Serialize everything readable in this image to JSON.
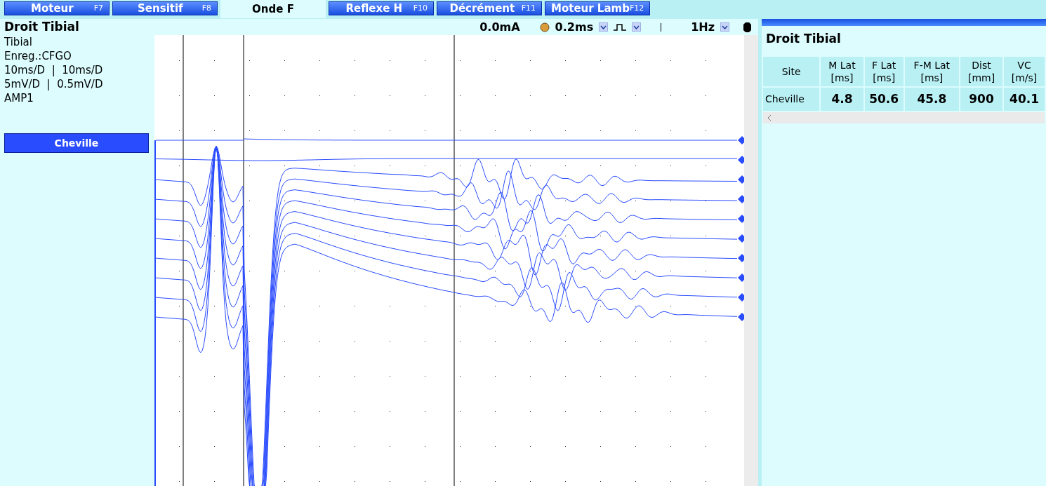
{
  "tabs": [
    {
      "label": "Moteur",
      "key": "F7",
      "selected": false
    },
    {
      "label": "Sensitif",
      "key": "F8",
      "selected": false
    },
    {
      "label": "Onde F",
      "selected": true
    },
    {
      "label": "Reflexe H",
      "key": "F10",
      "selected": false
    },
    {
      "label": "Décrément",
      "key": "F11",
      "selected": false
    },
    {
      "label": "Moteur Lamb",
      "key": "F12",
      "selected": false
    }
  ],
  "left_panel": {
    "title": "Droit Tibial",
    "lines": [
      "Tibial",
      "Enreg.:CFGO",
      "10ms/D  |  10ms/D",
      "5mV/D  |  0.5mV/D",
      "AMP1"
    ],
    "site_button": "Cheville"
  },
  "stim_bar": {
    "intensity": "0.0mA",
    "duration": "0.2ms",
    "frequency": "1Hz"
  },
  "results": {
    "title": "Droit Tibial",
    "columns": [
      "Site",
      "M Lat\n[ms]",
      "F Lat\n[ms]",
      "F-M Lat\n[ms]",
      "Dist\n[mm]",
      "VC\n[m/s]"
    ],
    "rows": [
      [
        "Cheville",
        "4.8",
        "50.6",
        "45.8",
        "900",
        "40.1"
      ]
    ]
  }
}
